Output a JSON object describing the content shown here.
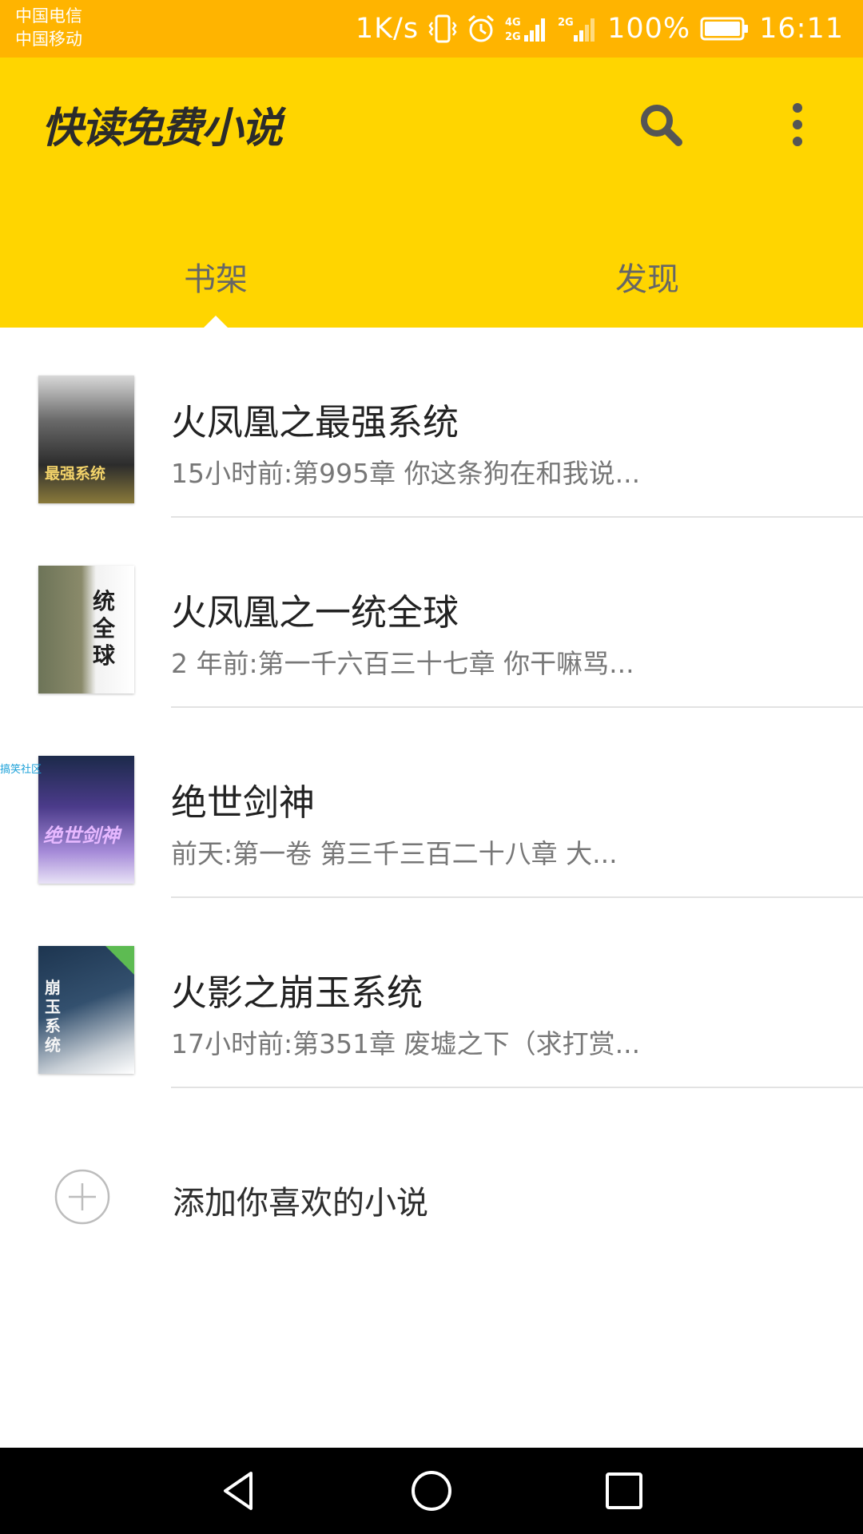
{
  "status_bar": {
    "carrier_1": "中国电信",
    "carrier_2": "中国移动",
    "net_speed": "1K/s",
    "battery": "100%",
    "time": "16:11",
    "icons": [
      "vibrate-icon",
      "alarm-icon",
      "signal-4g-icon",
      "signal-2g-icon",
      "battery-icon"
    ]
  },
  "app_bar": {
    "title": "快读免费小说",
    "actions": [
      "search-icon",
      "more-vert-icon"
    ],
    "background_color": "#FFD500"
  },
  "tabs": [
    {
      "label": "书架",
      "selected": true
    },
    {
      "label": "发现",
      "selected": false
    }
  ],
  "books": [
    {
      "title": "火凤凰之最强系统",
      "subtitle": "15小时前:第995章 你这条狗在和我说...",
      "cover_text": "最强系统"
    },
    {
      "title": "火凤凰之一统全球",
      "subtitle": "2 年前:第一千六百三十七章 你干嘛骂...",
      "cover_text": "统全球"
    },
    {
      "title": "绝世剑神",
      "subtitle": "前天:第一卷 第三千三百二十八章 大...",
      "cover_text": "绝世剑神"
    },
    {
      "title": "火影之崩玉系统",
      "subtitle": "17小时前:第351章 废墟之下（求打赏...",
      "cover_text": "崩玉系统"
    }
  ],
  "add_book": {
    "label": "添加你喜欢的小说"
  },
  "watermark": "搞笑社区",
  "nav_bar": {
    "buttons": [
      "back-icon",
      "home-icon",
      "recents-icon"
    ]
  }
}
